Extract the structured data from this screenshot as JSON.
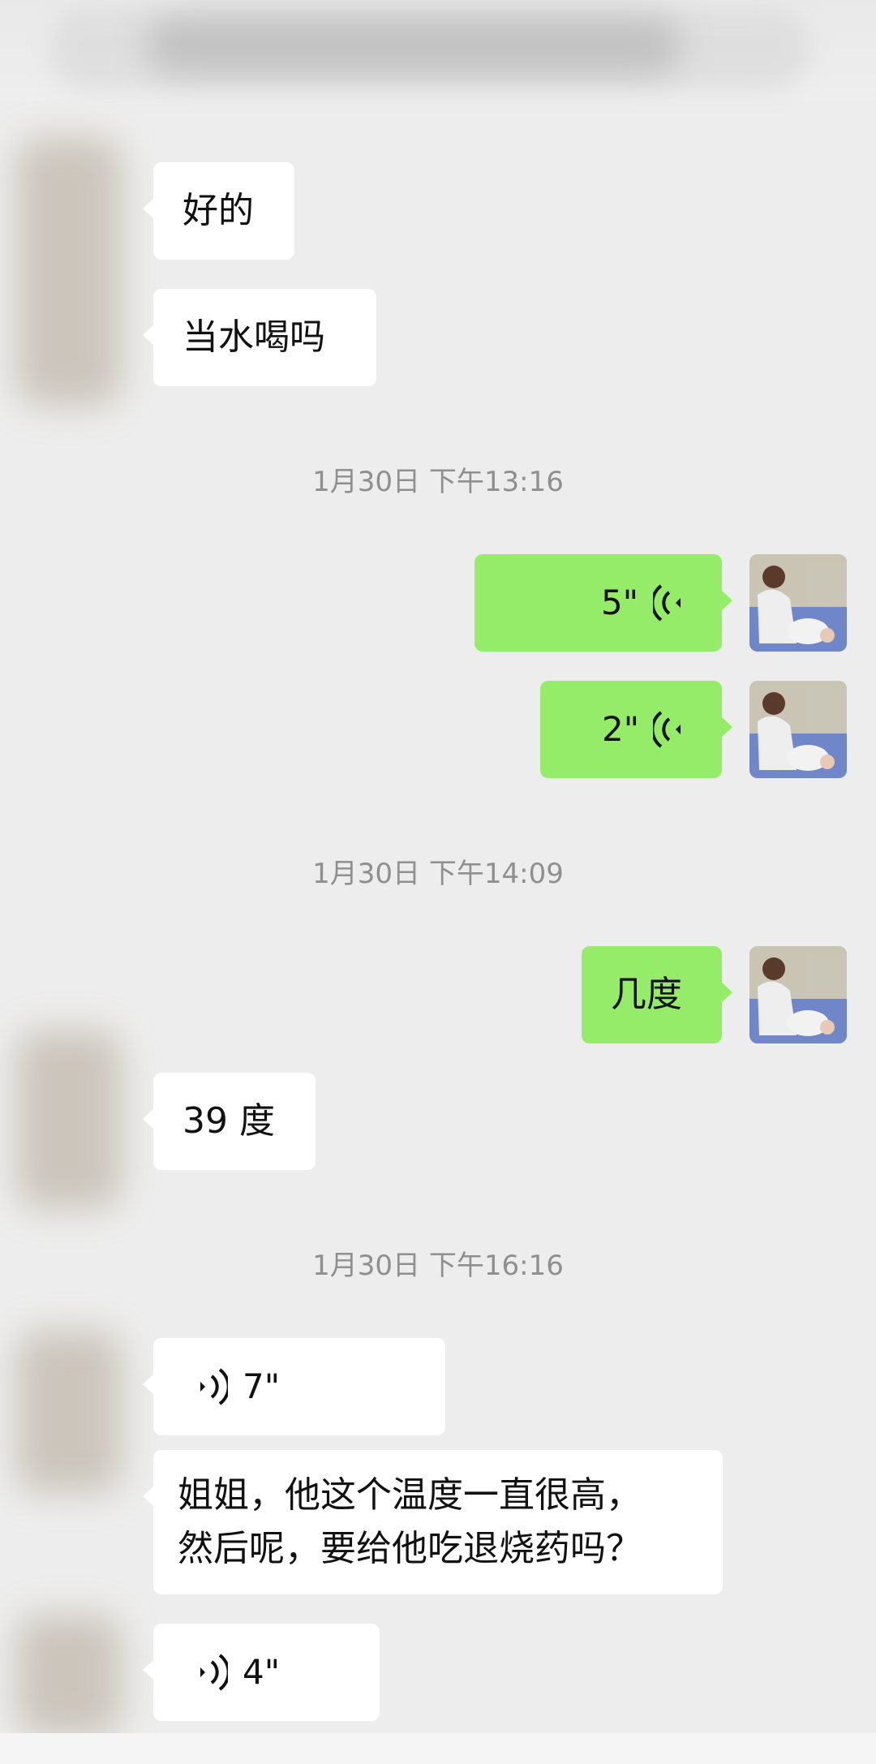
{
  "messages": {
    "m1": "好的",
    "m2": "当水喝吗",
    "m6": "几度",
    "m7": "39 度",
    "m9_line1": "姐姐，他这个温度一直很高，",
    "m9_line2": "然后呢，要给他吃退烧药吗？"
  },
  "timestamps": {
    "t1": "1月30日 下午13:16",
    "t2": "1月30日 下午14:09",
    "t3": "1月30日 下午16:16"
  },
  "voice": {
    "v1": "5\"",
    "v2": "2\"",
    "v3": "7\"",
    "v4": "4\""
  },
  "colors": {
    "background": "#ededed",
    "self_bubble": "#95ec69",
    "other_bubble": "#ffffff",
    "timestamp_text": "#8f8f8f"
  },
  "icons": {
    "voice": "voice-wave-icon"
  }
}
